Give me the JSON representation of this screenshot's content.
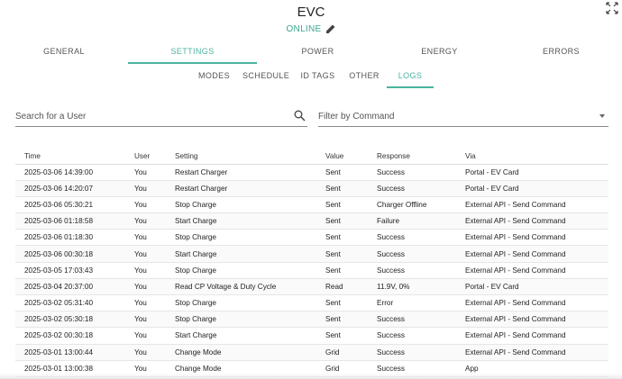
{
  "header": {
    "title": "EVC",
    "status": "ONLINE"
  },
  "tabs": [
    {
      "label": "GENERAL",
      "active": false
    },
    {
      "label": "SETTINGS",
      "active": true
    },
    {
      "label": "POWER",
      "active": false
    },
    {
      "label": "ENERGY",
      "active": false
    },
    {
      "label": "ERRORS",
      "active": false
    }
  ],
  "subtabs": [
    {
      "label": "MODES",
      "active": false
    },
    {
      "label": "SCHEDULE",
      "active": false
    },
    {
      "label": "ID TAGS",
      "active": false
    },
    {
      "label": "OTHER",
      "active": false
    },
    {
      "label": "LOGS",
      "active": true
    }
  ],
  "search": {
    "placeholder": "Search for a User"
  },
  "filter": {
    "label": "Filter by Command"
  },
  "table": {
    "columns": [
      "Time",
      "User",
      "Setting",
      "Value",
      "Response",
      "Via"
    ],
    "rows": [
      [
        "2025-03-06 14:39:00",
        "You",
        "Restart Charger",
        "Sent",
        "Success",
        "Portal - EV Card"
      ],
      [
        "2025-03-06 14:20:07",
        "You",
        "Restart Charger",
        "Sent",
        "Success",
        "Portal - EV Card"
      ],
      [
        "2025-03-06 05:30:21",
        "You",
        "Stop Charge",
        "Sent",
        "Charger Offline",
        "External API - Send Command"
      ],
      [
        "2025-03-06 01:18:58",
        "You",
        "Start Charge",
        "Sent",
        "Failure",
        "External API - Send Command"
      ],
      [
        "2025-03-06 01:18:30",
        "You",
        "Stop Charge",
        "Sent",
        "Success",
        "External API - Send Command"
      ],
      [
        "2025-03-06 00:30:18",
        "You",
        "Start Charge",
        "Sent",
        "Success",
        "External API - Send Command"
      ],
      [
        "2025-03-05 17:03:43",
        "You",
        "Stop Charge",
        "Sent",
        "Success",
        "External API - Send Command"
      ],
      [
        "2025-03-04 20:37:00",
        "You",
        "Read CP Voltage & Duty Cycle",
        "Read",
        "11.9V, 0%",
        "Portal - EV Card"
      ],
      [
        "2025-03-02 05:31:40",
        "You",
        "Stop Charge",
        "Sent",
        "Error",
        "External API - Send Command"
      ],
      [
        "2025-03-02 05:30:18",
        "You",
        "Stop Charge",
        "Sent",
        "Success",
        "External API - Send Command"
      ],
      [
        "2025-03-02 00:30:18",
        "You",
        "Start Charge",
        "Sent",
        "Success",
        "External API - Send Command"
      ],
      [
        "2025-03-01 13:00:44",
        "You",
        "Change Mode",
        "Grid",
        "Success",
        "External API - Send Command"
      ],
      [
        "2025-03-01 13:00:38",
        "You",
        "Change Mode",
        "Grid",
        "Success",
        "App"
      ]
    ]
  },
  "colors": {
    "accent": "#4bb39e",
    "status": "#3aa68e"
  },
  "icons": {
    "expand": "expand-icon",
    "edit": "pencil-icon",
    "search": "search-icon",
    "dropdown": "chevron-down-icon"
  }
}
